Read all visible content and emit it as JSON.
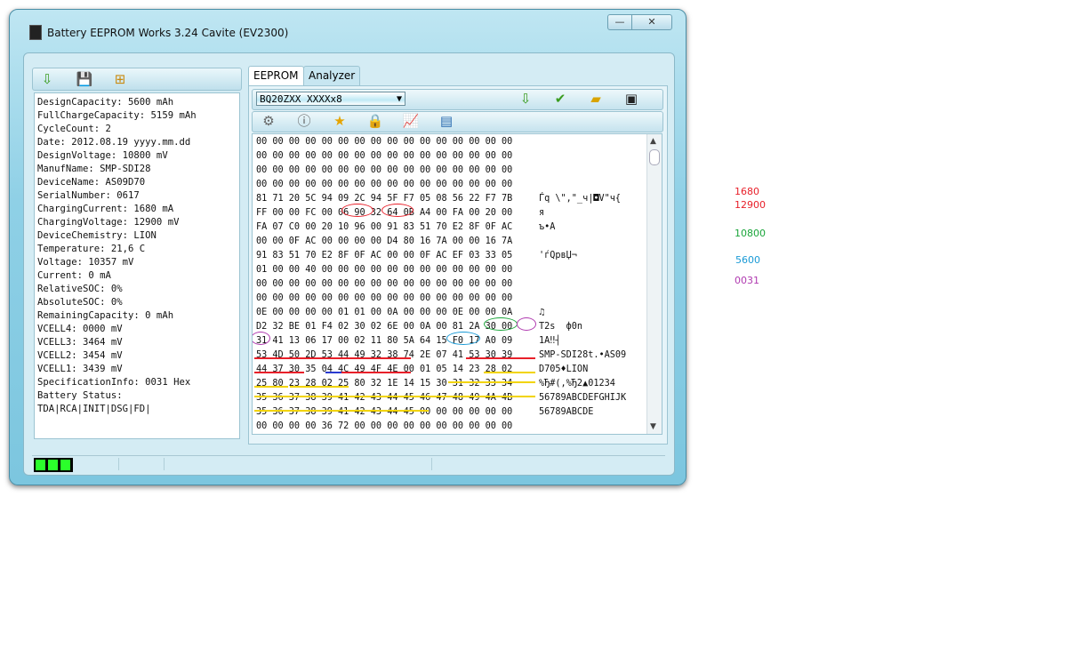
{
  "window": {
    "title": "Battery EEPROM Works  3.24 Cavite (EV2300)",
    "minimize_label": "—",
    "close_label": "✕"
  },
  "left_toolbar": {
    "icons": [
      "download-arrow-icon",
      "save-icon",
      "tree-icon"
    ]
  },
  "info_lines": [
    "DesignCapacity: 5600 mAh",
    "FullChargeCapacity: 5159 mAh",
    "CycleCount: 2",
    "Date: 2012.08.19 yyyy.mm.dd",
    "DesignVoltage: 10800 mV",
    "ManufName: SMP-SDI28",
    "DeviceName: AS09D70",
    "SerialNumber: 0617",
    "ChargingCurrent: 1680 mA",
    "ChargingVoltage: 12900 mV",
    "DeviceChemistry: LION",
    "Temperature: 21,6 C",
    "Voltage: 10357 mV",
    "Current: 0 mA",
    "RelativeSOC: 0%",
    "AbsoluteSOC: 0%",
    "RemainingCapacity: 0 mAh",
    "VCELL4: 0000 mV",
    "VCELL3: 3464 mV",
    "VCELL2: 3454 mV",
    "VCELL1: 3439 mV",
    "SpecificationInfo: 0031 Hex",
    "Battery Status:",
    "TDA|RCA|INIT|DSG|FD|"
  ],
  "tabs": [
    {
      "label": "EEPROM"
    },
    {
      "label": "Analyzer"
    }
  ],
  "chip_select": {
    "value": "BQ20ZXX    XXXXx8",
    "arrow": "▼"
  },
  "hex_rows": [
    {
      "hex": "00 00 00 00 00 00 00 00 00 00 00 00 00 00 00 00",
      "ascii": ""
    },
    {
      "hex": "00 00 00 00 00 00 00 00 00 00 00 00 00 00 00 00",
      "ascii": ""
    },
    {
      "hex": "00 00 00 00 00 00 00 00 00 00 00 00 00 00 00 00",
      "ascii": ""
    },
    {
      "hex": "00 00 00 00 00 00 00 00 00 00 00 00 00 00 00 00",
      "ascii": ""
    },
    {
      "hex": "81 71 20 5C 94 09 2C 94 5F F7 05 08 56 22 F7 7B",
      "ascii": "Ѓq \\\",\"_ч|◘V\"ч{"
    },
    {
      "hex": "FF 00 00 FC 00 06 90 32 64 0B A4 00 FA 00 20 00",
      "ascii": "я"
    },
    {
      "hex": "FA 07 C0 00 20 10 96 00 91 83 51 70 E2 8F 0F AC",
      "ascii": "ъ•А"
    },
    {
      "hex": "00 00 0F AC 00 00 00 00 D4 80 16 7A 00 00 16 7A",
      "ascii": ""
    },
    {
      "hex": "91 83 51 70 E2 8F 0F AC 00 00 0F AC EF 03 33 05",
      "ascii": "'ѓQpвЏ¬"
    },
    {
      "hex": "01 00 00 40 00 00 00 00 00 00 00 00 00 00 00 00",
      "ascii": ""
    },
    {
      "hex": "00 00 00 00 00 00 00 00 00 00 00 00 00 00 00 00",
      "ascii": ""
    },
    {
      "hex": "00 00 00 00 00 00 00 00 00 00 00 00 00 00 00 00",
      "ascii": ""
    },
    {
      "hex": "0E 00 00 00 00 01 01 00 0A 00 00 00 0E 00 00 0A",
      "ascii": "♫"
    },
    {
      "hex": "D2 32 BE 01 F4 02 30 02 6E 00 0A 00 81 2A 30 00",
      "ascii": "T2s  ф0n"
    },
    {
      "hex": "31 41 13 06 17 00 02 11 80 5A 64 15 F0 17 A0 09",
      "ascii": "1A‼┤"
    },
    {
      "hex": "53 4D 50 2D 53 44 49 32 38 74 2E 07 41 53 30 39",
      "ascii": "SMP-SDI28t.•AS09"
    },
    {
      "hex": "44 37 30 35 04 4C 49 4F 4E 00 01 05 14 23 28 02",
      "ascii": "D705♦LION"
    },
    {
      "hex": "25 80 23 28 02 25 80 32 1E 14 15 30 31 32 33 34",
      "ascii": "%Ђ#(‚%Ђ2▲01234"
    },
    {
      "hex": "35 36 37 38 39 41 42 43 44 45 46 47 48 49 4A 4B",
      "ascii": "56789ABCDEFGHIJK"
    },
    {
      "hex": "35 36 37 38 39 41 42 43 44 45 00 00 00 00 00 00",
      "ascii": "56789ABCDE"
    },
    {
      "hex": "00 00 00 00 36 72 00 00 00 00 00 00 00 00 00 00",
      "ascii": ""
    }
  ],
  "scrollbar": {
    "up": "▲",
    "down": "▼"
  },
  "side_notes": [
    {
      "text": "1680",
      "color": "#e8202a"
    },
    {
      "text": "12900",
      "color": "#e8202a"
    },
    {
      "text": "10800",
      "color": "#1aa53a"
    },
    {
      "text": "5600",
      "color": "#1a9ad6"
    },
    {
      "text": "0031",
      "color": "#b03ab0"
    }
  ]
}
